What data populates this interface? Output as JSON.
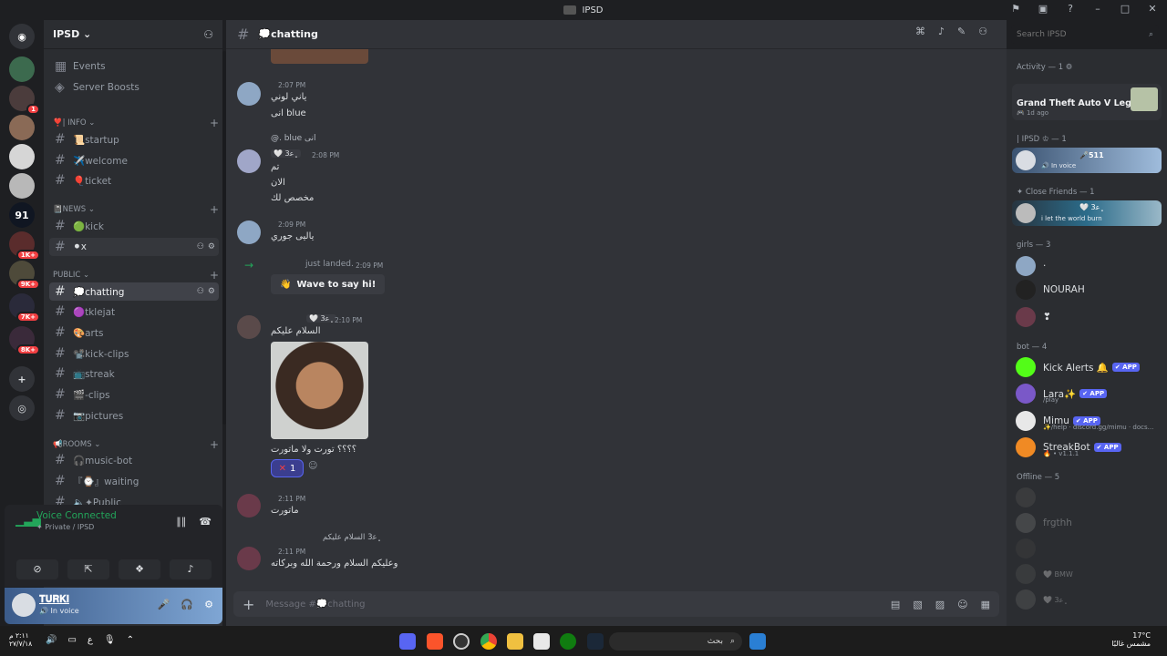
{
  "window": {
    "title": "IPSD"
  },
  "guilds": [
    {
      "label": "",
      "badge": ""
    },
    {
      "label": "",
      "badge": "1"
    },
    {
      "label": "",
      "badge": ""
    },
    {
      "label": "",
      "badge": ""
    },
    {
      "label": "",
      "badge": ""
    },
    {
      "label": "91",
      "badge": ""
    },
    {
      "label": "",
      "badge": "1K+"
    },
    {
      "label": "",
      "badge": "9K+"
    },
    {
      "label": "",
      "badge": "7K+"
    },
    {
      "label": "",
      "badge": "8K+"
    }
  ],
  "server": {
    "name": "IPSD ⌄"
  },
  "nav": {
    "events": "Events",
    "boosts": "Server Boosts"
  },
  "categories": {
    "info": "❣️| INFO ⌄",
    "news": "📓NEWS ⌄",
    "public": "PUBLIC ⌄",
    "rooms": "📢Rooms ⌄"
  },
  "channels": {
    "startup": "📜startup",
    "welcome": "✈️welcome",
    "ticket": "🎈ticket",
    "kick": "🟢kick",
    "x": "⚫x",
    "chatting": "💭chatting",
    "tklejat": "🟣tklejat",
    "arts": "🎨arts",
    "kick_clips": "📽️kick-clips",
    "streak": "📺streak",
    "clips": "🎬-clips",
    "pictures": "📷pictures",
    "music_bot": "🎧music-bot",
    "waiting": "『⌚』waiting",
    "public_voice": "🔈✦Public"
  },
  "voice": {
    "status": "Voice Connected",
    "location": "✦ Private / IPSD"
  },
  "user": {
    "name": "𝐓𝐔𝐑𝐊𝐈",
    "status": "🔊 In voice"
  },
  "header": {
    "channel": "💭chatting"
  },
  "search": {
    "placeholder": "Search IPSD"
  },
  "messages": {
    "m1": {
      "time": "2:07 PM",
      "line1": "ياني لوني",
      "line2": "انى blue"
    },
    "m2": {
      "reply": "@. blue انى",
      "badge": "🤍 ﮼ﻋ3",
      "time": "2:08 PM",
      "line1": "تم",
      "line2": "الان",
      "line3": "مخصص لك"
    },
    "m3": {
      "time": "2:09 PM",
      "line1": "ياليى جوري"
    },
    "m4": {
      "text": "just landed.",
      "time": "2:09 PM",
      "wave": "Wave to say hi!"
    },
    "m5": {
      "badge": "🤍 ﮼ﻋ3",
      "time": "2:10 PM",
      "line1": "السلام عليكم",
      "caption": "؟؟؟؟ تورت ولا ماتورت",
      "reaction_count": "1"
    },
    "m6": {
      "time": "2:11 PM",
      "line1": "ماتورت"
    },
    "m7": {
      "reply": "﮼ﻋ3  السلام عليكم",
      "time": "2:11 PM",
      "line1": "وعليكم السلام ورحمة الله وبركاته"
    }
  },
  "composer": {
    "placeholder": "Message #💭chatting"
  },
  "members": {
    "activity_head": "Activity — 1 ⚙",
    "activity_game": "Grand Theft Auto V Legacy",
    "activity_time": "🎮 1d ago",
    "ipsd_head": "| IPSD ♔ — 1",
    "ipsd_member": "🎤511",
    "ipsd_status": "🔊 In voice",
    "cf_head": "✦ Close Friends — 1",
    "cf_badge": "🤍 ﮼ﻋ3",
    "cf_status": "i let the world burn",
    "girls_head": "girls — 3",
    "g1": "·",
    "g2": "NOURAH",
    "g3": "❣",
    "bot_head": "bot — 4",
    "bot1": "Kick Alerts 🔔",
    "bot2": "Lara✨",
    "bot2_status": "/play",
    "bot3": "Mimu",
    "bot3_status": "✨/help · discord.gg/mimu · docs...",
    "bot4": "StreakBot",
    "bot4_status": "🔥 • v1.1.1",
    "app_tag": "✔ APP",
    "offline_head": "Offline — 5",
    "o2": "frgthh",
    "o4": "🤍 BMW",
    "o5": "🤍 ﮼ﻋ3"
  },
  "taskbar": {
    "clock_time": "٢:١١ م",
    "clock_date": "٢٧/٧/١٨",
    "tray_lang": "ع",
    "search_label": "بحث",
    "weather_temp": "17°C",
    "weather_desc": "مشمس غالبًا"
  }
}
